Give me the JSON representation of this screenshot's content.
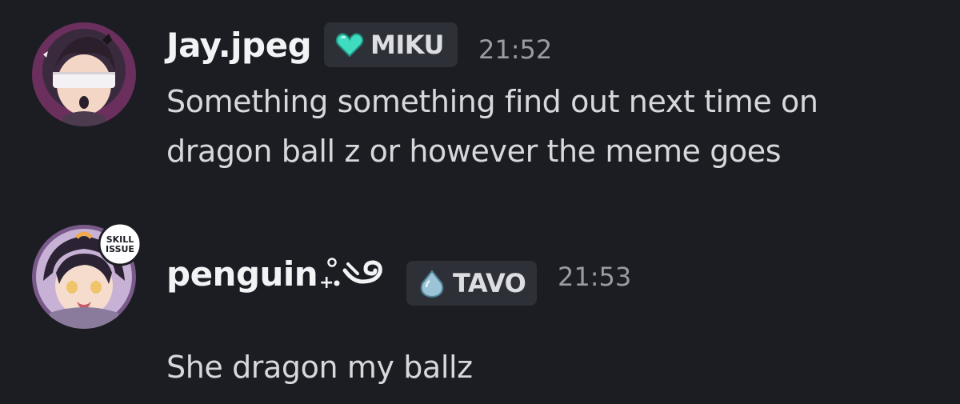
{
  "messages": [
    {
      "username": "Jay.jpeg",
      "role": {
        "name": "MIKU",
        "icon": "teal-heart-icon",
        "color": "#3fdcc0"
      },
      "timestamp": "21:52",
      "lines": [
        "Something something find out next time on",
        "dragon ball z or however the meme goes"
      ],
      "avatar": "avatar-icon"
    },
    {
      "username": "penguin",
      "username_decoration": "sparkle-swirl-decoration",
      "avatar_badge": {
        "line1": "SKILL",
        "line2": "ISSUE"
      },
      "role": {
        "name": "TAVO",
        "icon": "water-drop-icon",
        "color": "#7fb3c8"
      },
      "timestamp": "21:53",
      "lines": [
        "She dragon my ballz"
      ],
      "avatar": "avatar-icon"
    }
  ],
  "colors": {
    "background": "#1c1d22",
    "username": "#f2f3f5",
    "message_text": "#d6d8dc",
    "timestamp": "#9a9ca3",
    "role_tag_bg": "#2e3038"
  }
}
